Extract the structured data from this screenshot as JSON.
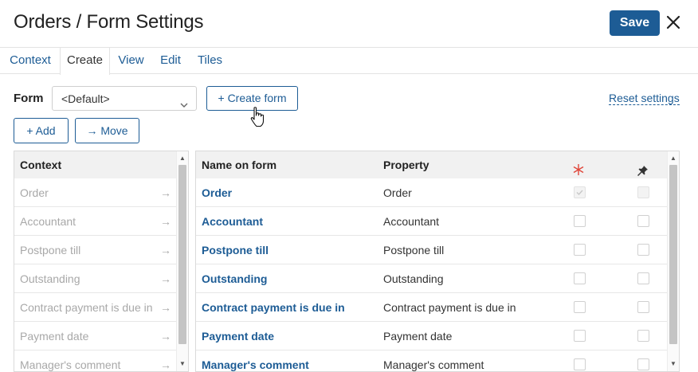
{
  "header": {
    "title": "Orders / Form Settings",
    "save_label": "Save",
    "close_icon": "close-icon"
  },
  "tabs": [
    {
      "label": "Context",
      "active": false
    },
    {
      "label": "Create",
      "active": true
    },
    {
      "label": "View",
      "active": false
    },
    {
      "label": "Edit",
      "active": false
    },
    {
      "label": "Tiles",
      "active": false
    }
  ],
  "toolbar": {
    "form_label": "Form",
    "form_select_value": "<Default>",
    "create_form_label": "+ Create form",
    "reset_label": "Reset settings",
    "add_label": "+ Add",
    "move_label": "→ Move"
  },
  "context_panel": {
    "header": "Context",
    "items": [
      {
        "label": "Order",
        "arrow": "→"
      },
      {
        "label": "Accountant",
        "arrow": "→"
      },
      {
        "label": "Postpone till",
        "arrow": "→"
      },
      {
        "label": "Outstanding",
        "arrow": "→"
      },
      {
        "label": "Contract payment is due in",
        "arrow": "→"
      },
      {
        "label": "Payment date",
        "arrow": "→"
      },
      {
        "label": "Manager's comment",
        "arrow": "→"
      }
    ]
  },
  "fields_grid": {
    "columns": {
      "name": "Name on form",
      "property": "Property",
      "required_icon": "asterisk-icon",
      "pin_icon": "pin-icon"
    },
    "rows": [
      {
        "name": "Order",
        "property": "Order",
        "required": true,
        "required_disabled": true,
        "pinned": false,
        "pinned_disabled": true
      },
      {
        "name": "Accountant",
        "property": "Accountant",
        "required": false,
        "required_disabled": false,
        "pinned": false,
        "pinned_disabled": false
      },
      {
        "name": "Postpone till",
        "property": "Postpone till",
        "required": false,
        "required_disabled": false,
        "pinned": false,
        "pinned_disabled": false
      },
      {
        "name": "Outstanding",
        "property": "Outstanding",
        "required": false,
        "required_disabled": false,
        "pinned": false,
        "pinned_disabled": false
      },
      {
        "name": "Contract payment is due in",
        "property": "Contract payment is due in",
        "required": false,
        "required_disabled": false,
        "pinned": false,
        "pinned_disabled": false
      },
      {
        "name": "Payment date",
        "property": "Payment date",
        "required": false,
        "required_disabled": false,
        "pinned": false,
        "pinned_disabled": false
      },
      {
        "name": "Manager's comment",
        "property": "Manager's comment",
        "required": false,
        "required_disabled": false,
        "pinned": false,
        "pinned_disabled": false
      }
    ]
  },
  "colors": {
    "accent": "#1d5c95",
    "required_star": "#e0463a",
    "muted_text": "#a8a8a8"
  }
}
